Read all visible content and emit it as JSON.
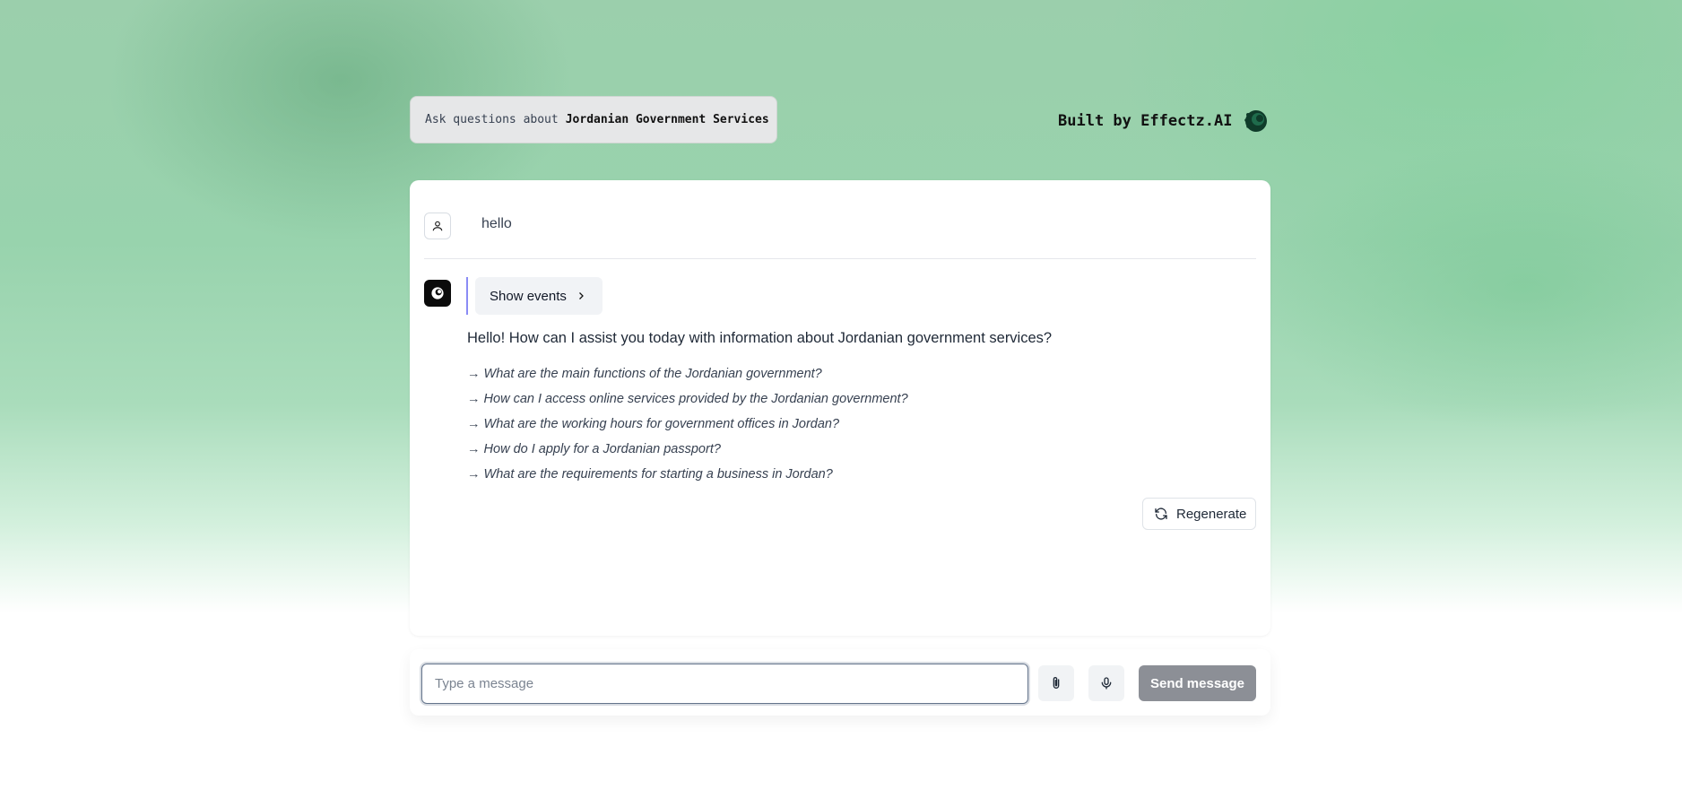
{
  "header": {
    "topic_prefix": "Ask questions about",
    "topic_name": "Jordanian Government Services",
    "built_by": "Built by Effectz.AI",
    "brand_icon": "effectz-logo-icon"
  },
  "conversation": {
    "user_message": "hello",
    "user_avatar_icon": "user-icon",
    "assistant_avatar_icon": "effectz-logo-icon",
    "events_button_label": "Show events",
    "assistant_message": "Hello! How can I assist you today with information about Jordanian government services?",
    "suggestions": [
      "→ What are the main functions of the Jordanian government?",
      "→ How can I access online services provided by the Jordanian government?",
      "→ What are the working hours for government offices in Jordan?",
      "→ How do I apply for a Jordanian passport?",
      "→ What are the requirements for starting a business in Jordan?"
    ],
    "regenerate_label": "Regenerate"
  },
  "composer": {
    "placeholder": "Type a message",
    "attach_icon": "paperclip-icon",
    "mic_icon": "microphone-icon",
    "send_label": "Send message"
  },
  "colors": {
    "accent_bar": "#6366f1",
    "send_button_bg": "#8c8f96",
    "card_bg": "#ffffff"
  }
}
